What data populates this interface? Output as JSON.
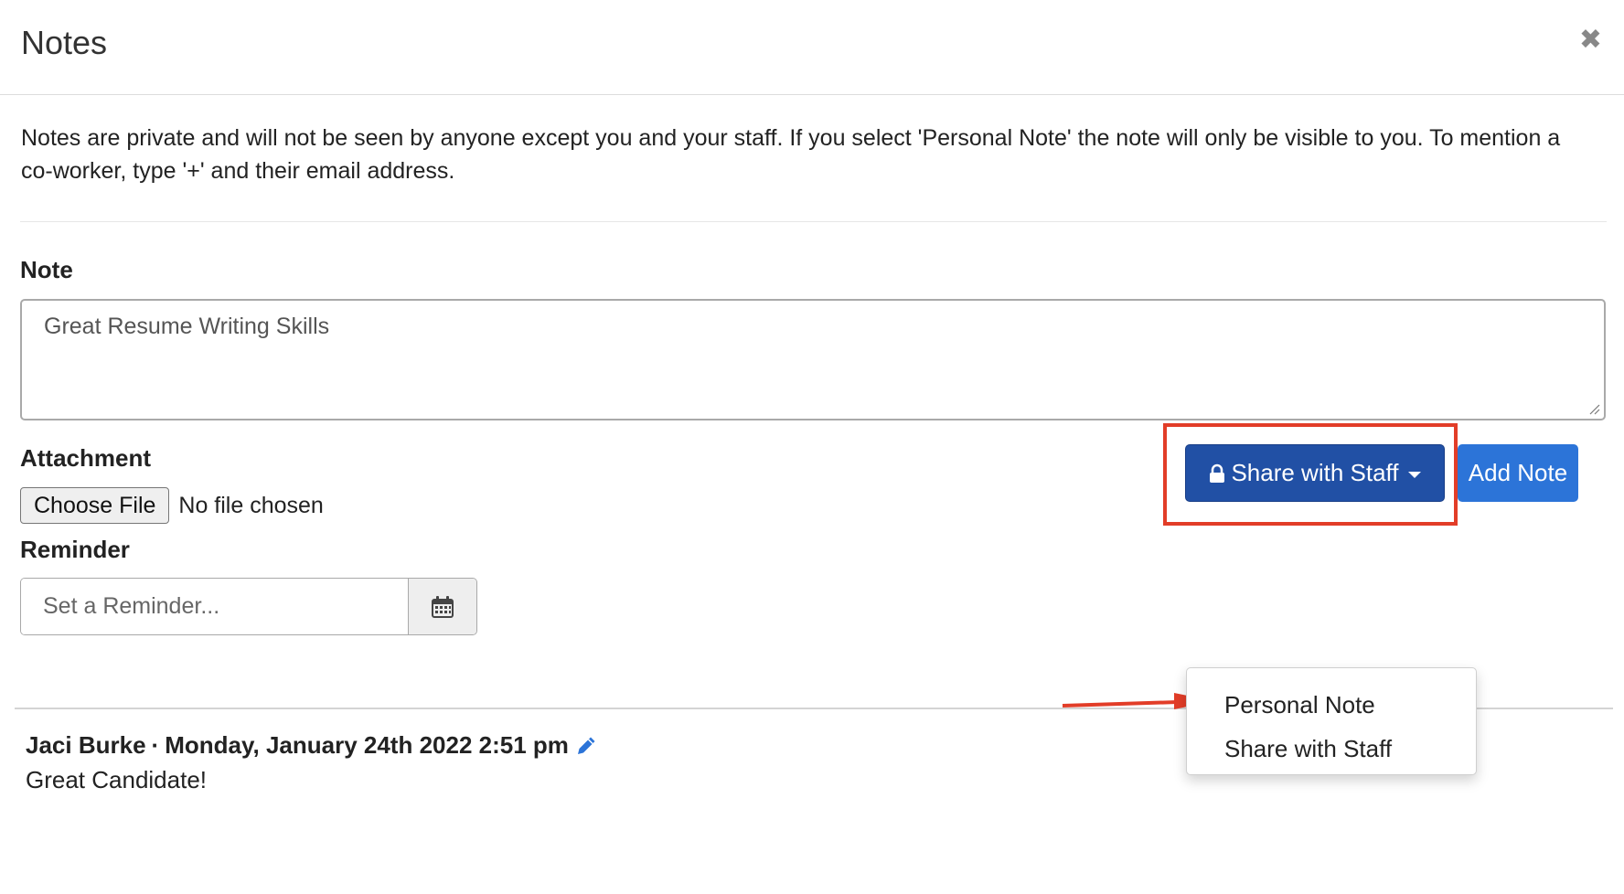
{
  "header": {
    "title": "Notes",
    "close_symbol": "✖"
  },
  "intro": {
    "text": "Notes are private and will not be seen by anyone except you and your staff. If you select 'Personal Note' the note will only be visible to you. To mention a co-worker, type '+' and their email address."
  },
  "note": {
    "label": "Note",
    "value": "Great Resume Writing Skills"
  },
  "attachment": {
    "label": "Attachment",
    "button_label": "Choose File",
    "status": "No file chosen"
  },
  "reminder": {
    "label": "Reminder",
    "placeholder": "Set a Reminder..."
  },
  "actions": {
    "share_label": "Share with Staff",
    "add_label": "Add Note"
  },
  "dropdown": {
    "items": [
      "Personal Note",
      "Share with Staff"
    ]
  },
  "entry": {
    "author": "Jaci Burke",
    "separator": "·",
    "timestamp": "Monday, January 24th 2022 2:51 pm",
    "text": "Great Candidate!"
  },
  "colors": {
    "primary": "#2150a5",
    "add": "#2c74d8",
    "highlight": "#e23d28",
    "edit_icon": "#2c74d8"
  },
  "icons": {
    "close": "close-icon",
    "lock": "lock-icon",
    "calendar": "calendar-icon",
    "edit": "pencil-icon",
    "caret": "caret-down-icon"
  }
}
